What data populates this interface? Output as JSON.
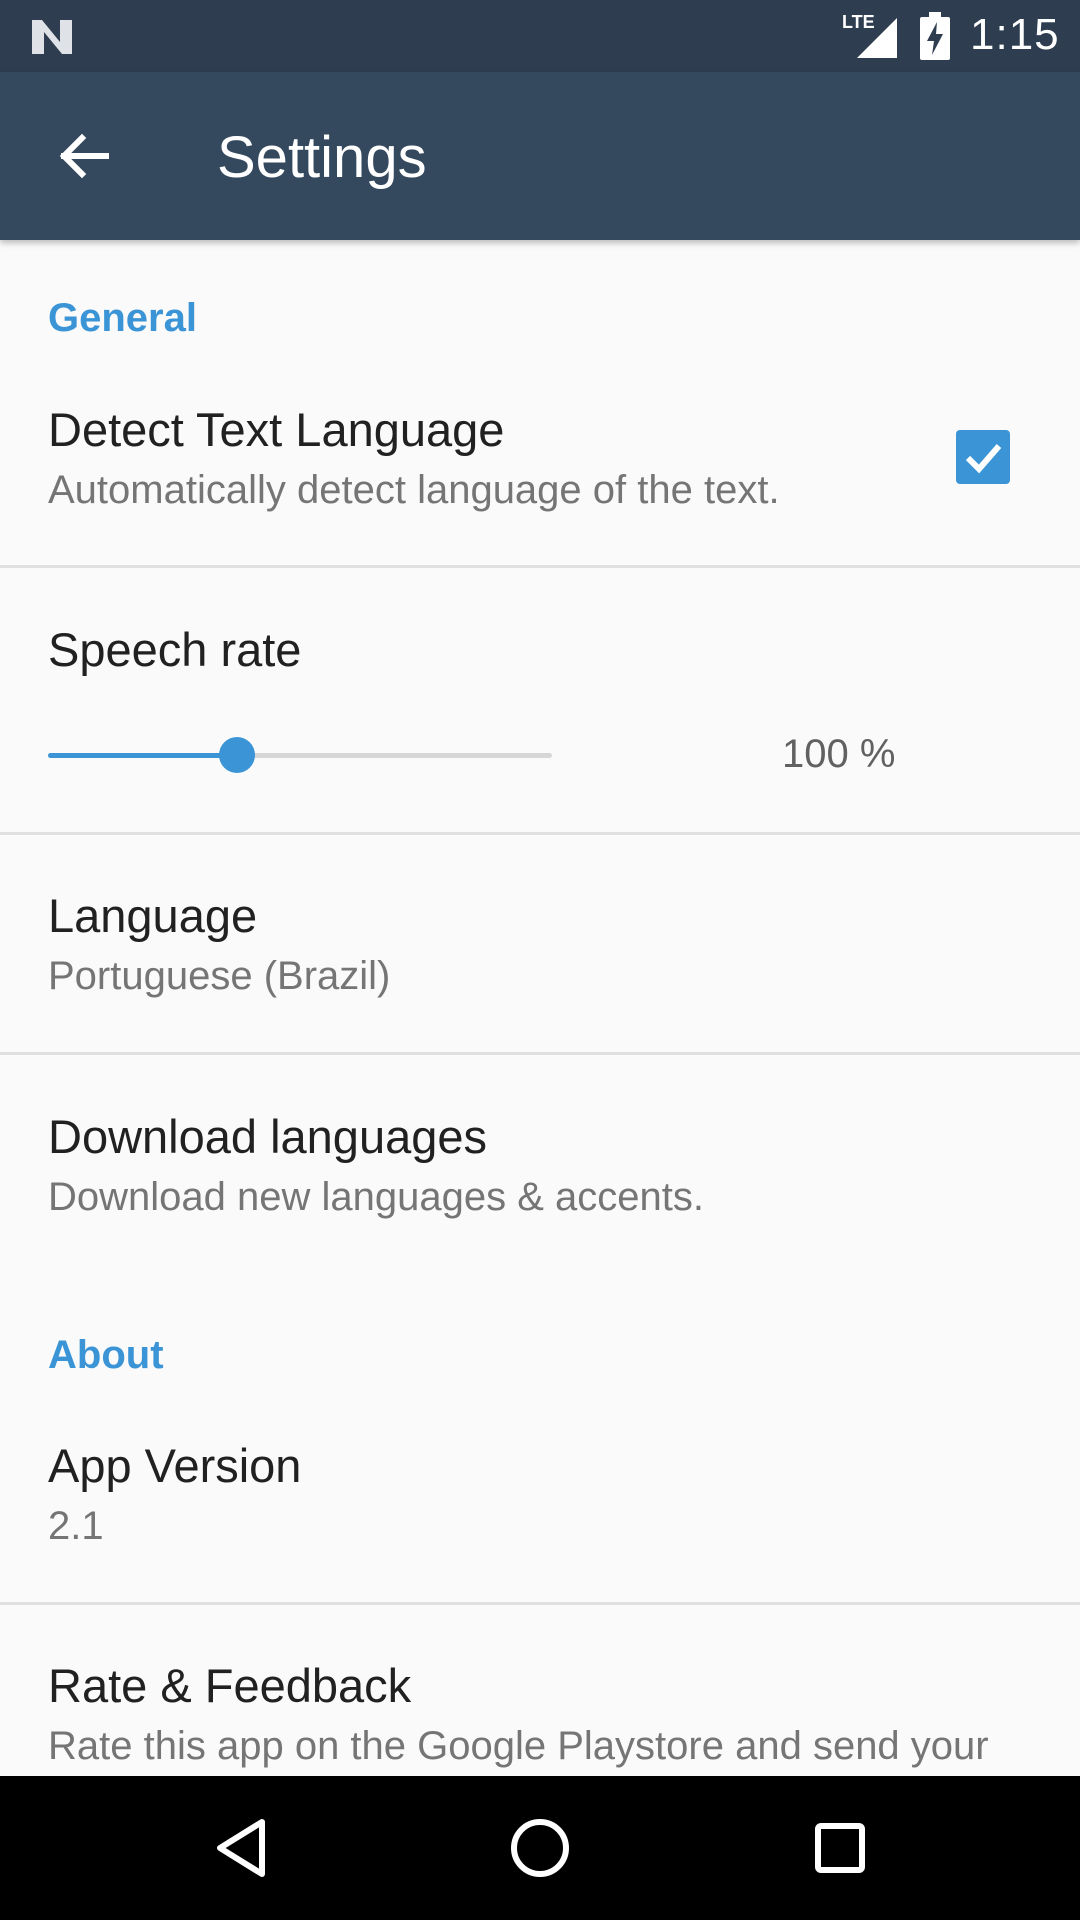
{
  "status_bar": {
    "time": "1:15",
    "network_label": "LTE"
  },
  "app_bar": {
    "title": "Settings"
  },
  "general": {
    "header": "General",
    "detect_text_language": {
      "title": "Detect Text Language",
      "summary": "Automatically detect language of the text.",
      "checked": true
    },
    "speech_rate": {
      "title": "Speech rate",
      "value_label": "100 %",
      "slider_fraction": 0.375
    },
    "language": {
      "title": "Language",
      "summary": "Portuguese (Brazil)"
    },
    "download_languages": {
      "title": "Download languages",
      "summary": "Download new languages & accents."
    }
  },
  "about": {
    "header": "About",
    "app_version": {
      "title": "App Version",
      "summary": "2.1"
    },
    "rate_feedback": {
      "title": "Rate & Feedback",
      "summary": "Rate this app on the Google Playstore and send your"
    }
  },
  "colors": {
    "status_bar": "#2e3d50",
    "app_bar": "#34495e",
    "accent": "#3a94d6",
    "background": "#fafafa"
  }
}
